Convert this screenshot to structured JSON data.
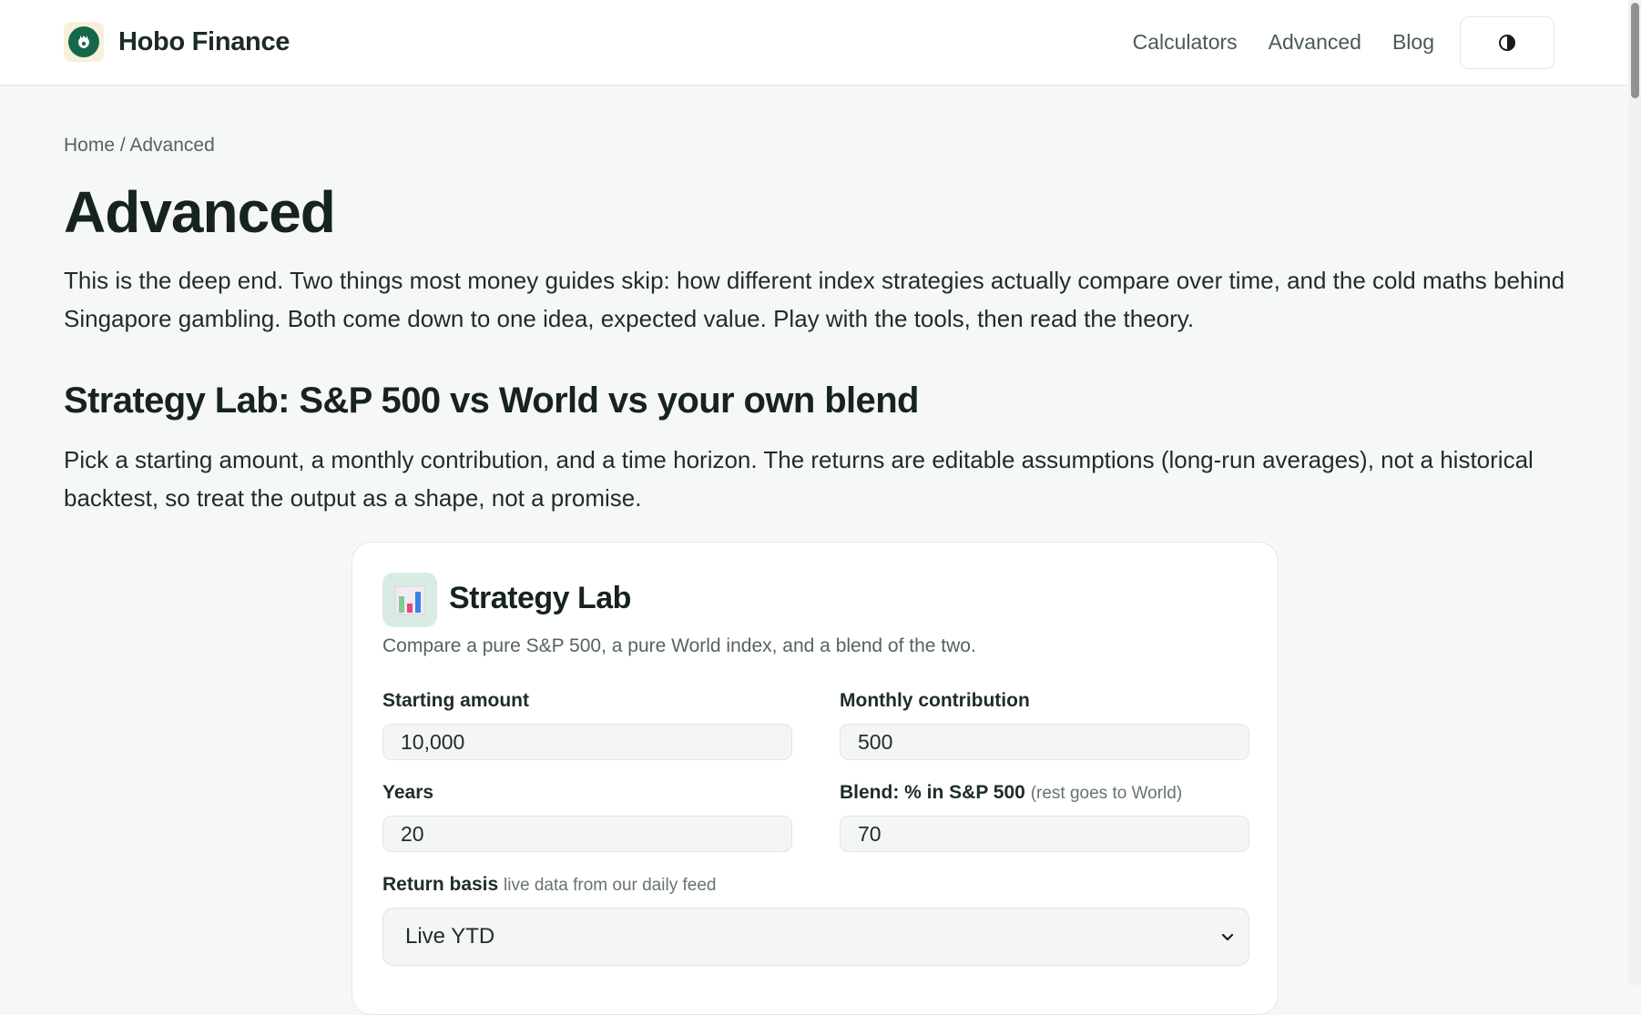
{
  "header": {
    "brand": "Hobo Finance",
    "nav": [
      "Calculators",
      "Advanced",
      "Blog"
    ],
    "theme_toggle_icon": "contrast-icon"
  },
  "breadcrumb": "Home / Advanced",
  "page": {
    "title": "Advanced",
    "intro": "This is the deep end. Two things most money guides skip: how different index strategies actually compare over time, and the cold maths behind Singapore gambling. Both come down to one idea, expected value. Play with the tools, then read the theory."
  },
  "section": {
    "title": "Strategy Lab: S&P 500 vs World vs your own blend",
    "description": "Pick a starting amount, a monthly contribution, and a time horizon. The returns are editable assumptions (long-run averages), not a historical backtest, so treat the output as a shape, not a promise."
  },
  "card": {
    "icon": "bar-chart-icon",
    "title": "Strategy Lab",
    "subtitle": "Compare a pure S&P 500, a pure World index, and a blend of the two.",
    "fields": {
      "starting_amount": {
        "label": "Starting amount",
        "value": "10,000"
      },
      "monthly_contribution": {
        "label": "Monthly contribution",
        "value": "500"
      },
      "years": {
        "label": "Years",
        "value": "20"
      },
      "blend": {
        "label": "Blend: % in S&P 500",
        "note": "(rest goes to World)",
        "value": "70"
      }
    },
    "return_basis": {
      "label": "Return basis",
      "note": "live data from our daily feed",
      "selected": "Live YTD"
    }
  },
  "colors": {
    "brand_green": "#17684a",
    "background": "#f6f8f7",
    "text": "#16231e"
  }
}
